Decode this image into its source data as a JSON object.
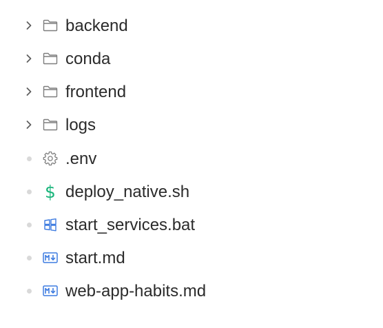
{
  "file_tree": {
    "items": [
      {
        "name": "backend",
        "type": "folder",
        "expandable": true,
        "icon": "folder-icon"
      },
      {
        "name": "conda",
        "type": "folder",
        "expandable": true,
        "icon": "folder-icon"
      },
      {
        "name": "frontend",
        "type": "folder",
        "expandable": true,
        "icon": "folder-icon"
      },
      {
        "name": "logs",
        "type": "folder",
        "expandable": true,
        "icon": "folder-icon"
      },
      {
        "name": ".env",
        "type": "file",
        "expandable": false,
        "icon": "gear-icon"
      },
      {
        "name": "deploy_native.sh",
        "type": "file",
        "expandable": false,
        "icon": "dollar-icon",
        "icon_glyph": "$",
        "icon_color": "#18b47a"
      },
      {
        "name": "start_services.bat",
        "type": "file",
        "expandable": false,
        "icon": "windows-icon",
        "icon_color": "#3d7be0"
      },
      {
        "name": "start.md",
        "type": "file",
        "expandable": false,
        "icon": "markdown-icon",
        "icon_color": "#3d7be0"
      },
      {
        "name": "web-app-habits.md",
        "type": "file",
        "expandable": false,
        "icon": "markdown-icon",
        "icon_color": "#3d7be0"
      }
    ]
  },
  "colors": {
    "text": "#2b2b2b",
    "icon_gray": "#7d7d7d",
    "dot": "#d9d9d9",
    "shell_green": "#18b47a",
    "blue": "#3d7be0"
  }
}
